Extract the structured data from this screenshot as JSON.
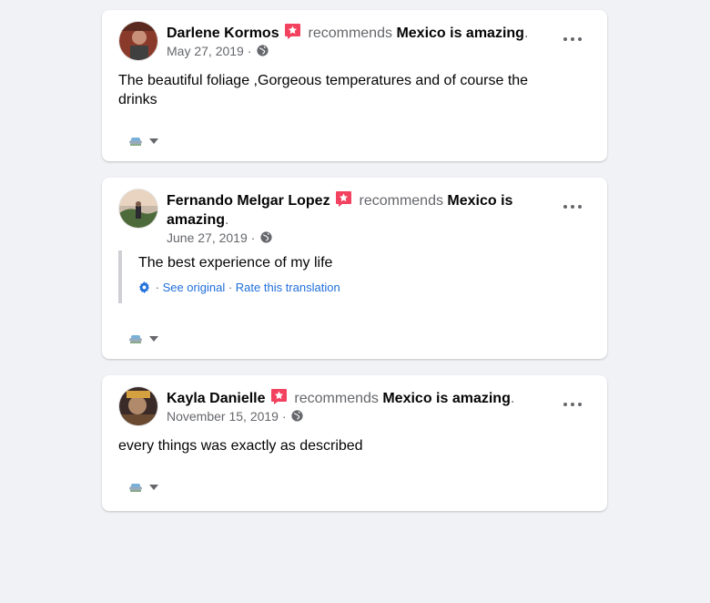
{
  "posts": [
    {
      "author": "Darlene Kormos",
      "verb": "recommends",
      "page": "Mexico is amazing",
      "date": "May 27, 2019 ·",
      "text": "The beautiful foliage ,Gorgeous temperatures and of course the drinks"
    },
    {
      "author": "Fernando Melgar Lopez",
      "verb": "recommends",
      "page": "Mexico is amazing",
      "date": "June 27, 2019 ·",
      "translation": {
        "text": "The best experience of my life",
        "see_original": "See original",
        "rate": "Rate this translation"
      }
    },
    {
      "author": "Kayla Danielle",
      "verb": "recommends",
      "page": "Mexico is amazing",
      "date": "November 15, 2019 ·",
      "text": "every things was exactly as described"
    }
  ],
  "colors": {
    "background": "#f0f2f5",
    "card": "#ffffff",
    "recommend_badge": "#f3425f",
    "link": "#216fdb",
    "secondary_text": "#65676b"
  },
  "icons": [
    "recommend-star-icon",
    "globe-icon",
    "more-options-icon",
    "gear-icon",
    "reaction-icon",
    "caret-down-icon"
  ]
}
